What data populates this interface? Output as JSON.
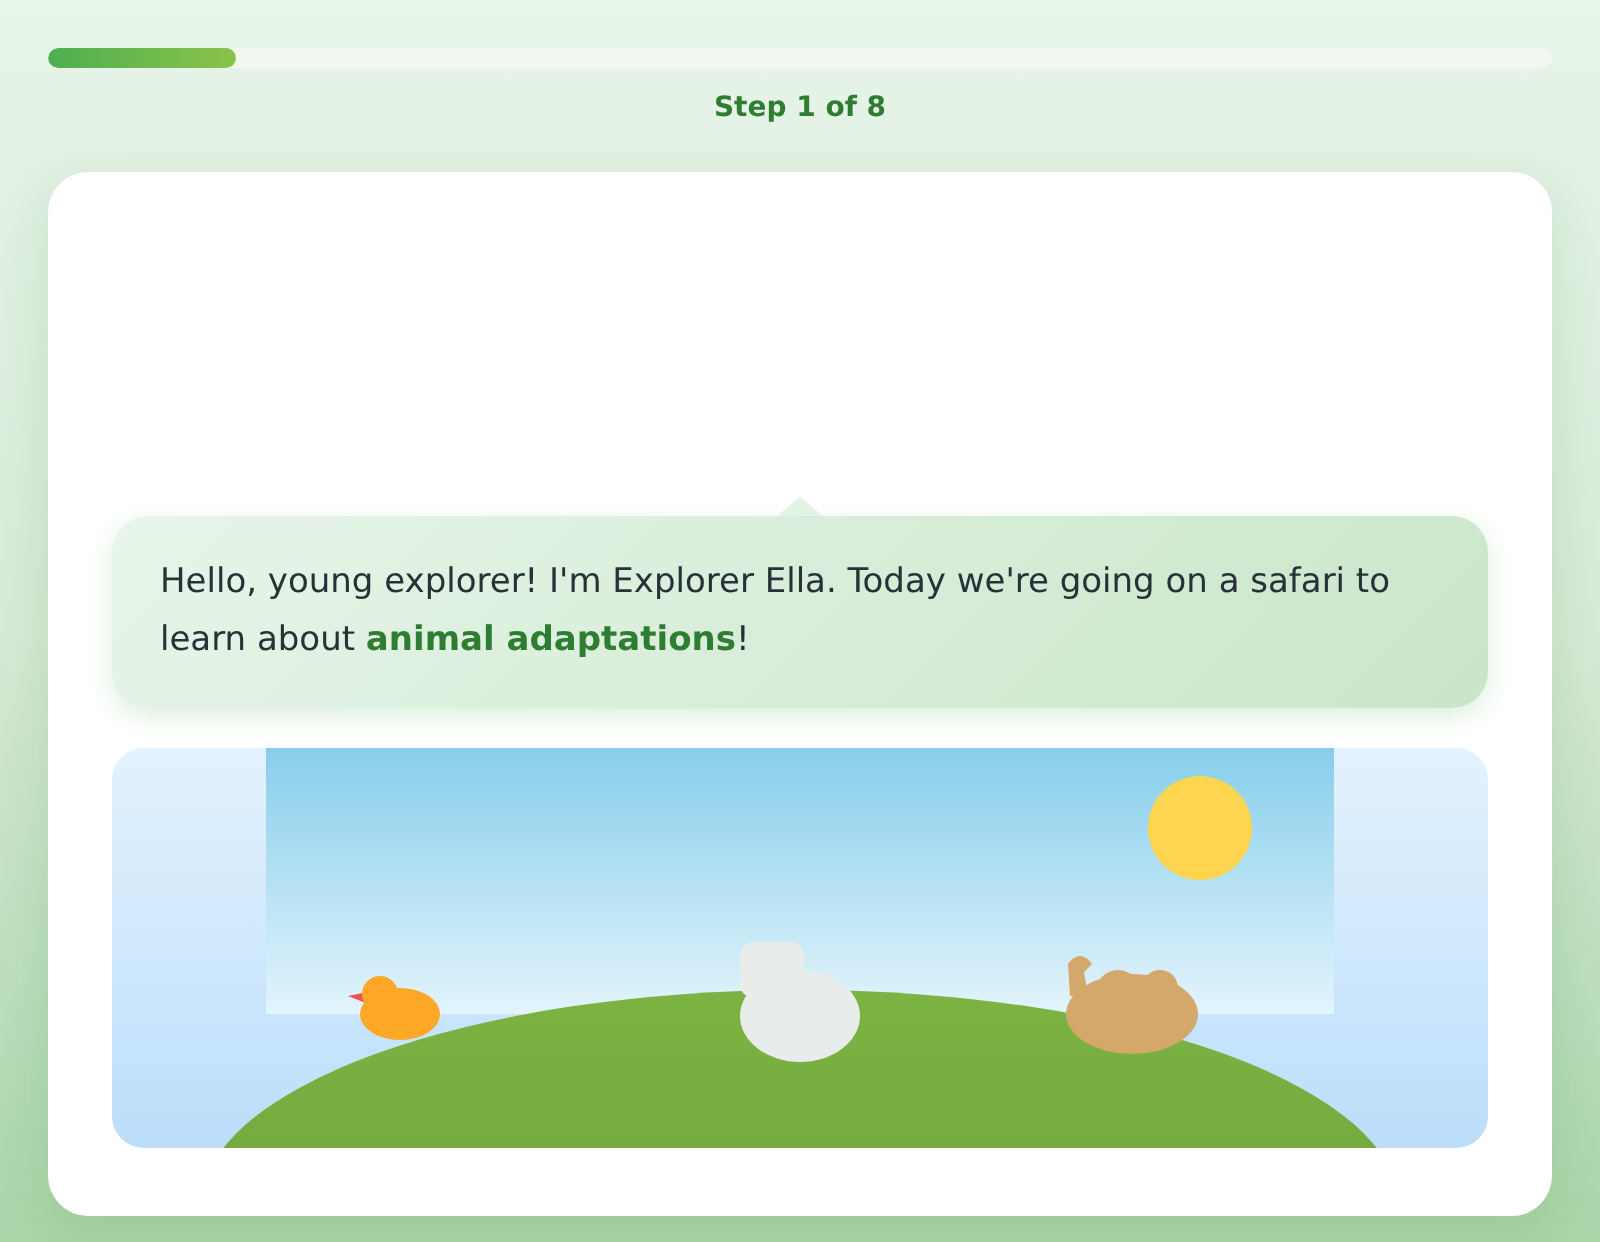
{
  "progress": {
    "level": 0.125,
    "label": "Step 1 of 8"
  },
  "speech_bubble": {
    "text": "Hello, young explorer! I'm Explorer Ella. Today we're going on a safari to learn about **animal adaptations**!"
  }
}
